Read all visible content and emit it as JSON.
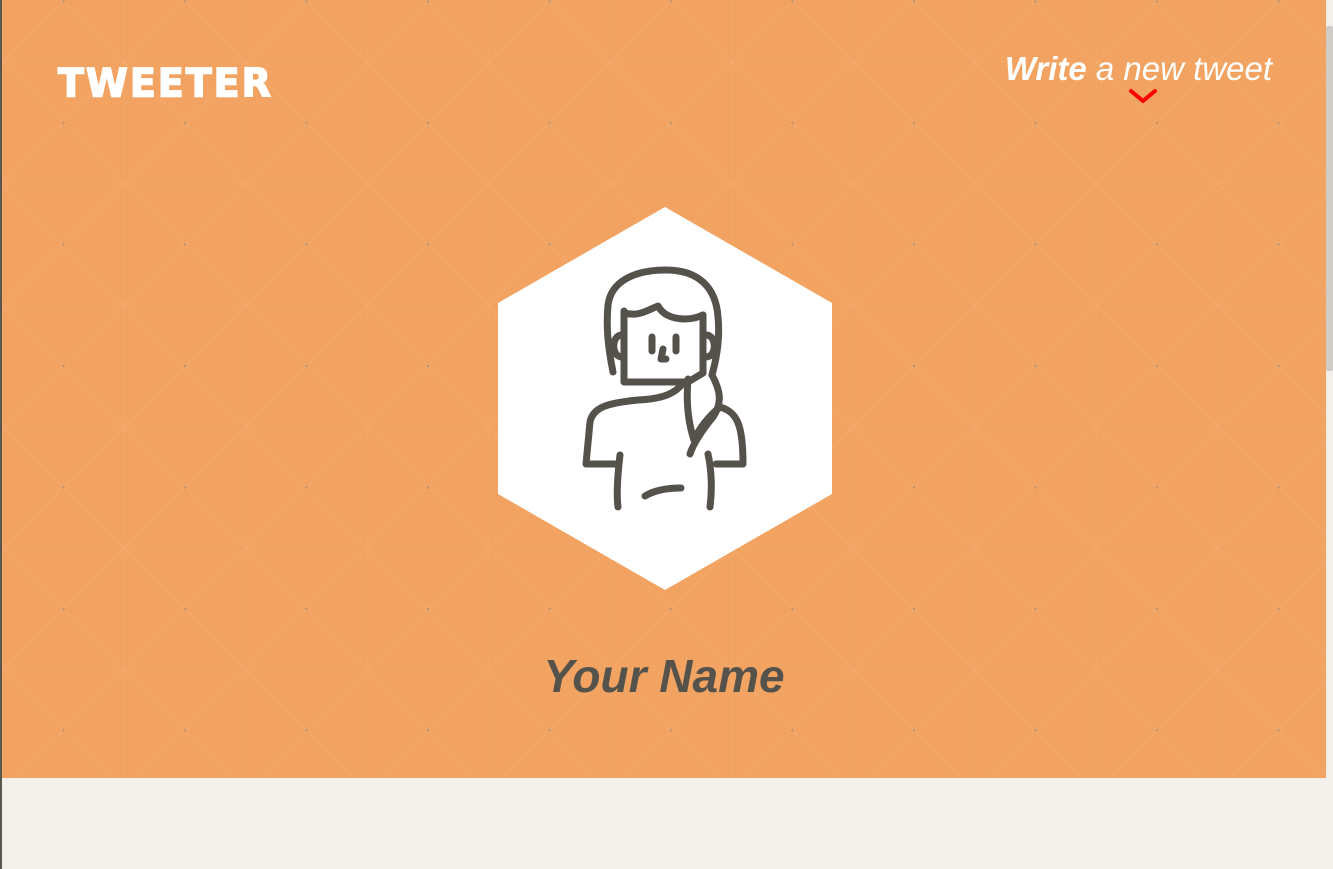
{
  "app": {
    "brand": "TWEETER"
  },
  "header": {
    "compose": {
      "strong": "Write",
      "light": " a new tweet",
      "chevron_icon": "chevron-down-icon",
      "chevron_color": "#ff0000"
    }
  },
  "profile": {
    "name": "Your Name",
    "avatar_icon": "woman-avatar-icon"
  },
  "colors": {
    "hero_background": "#f2a361",
    "page_background": "#f3f0ec",
    "avatar_background": "#ffffff",
    "avatar_line": "#55524c",
    "name_text": "#55524c",
    "brand_text": "#ffffff"
  }
}
